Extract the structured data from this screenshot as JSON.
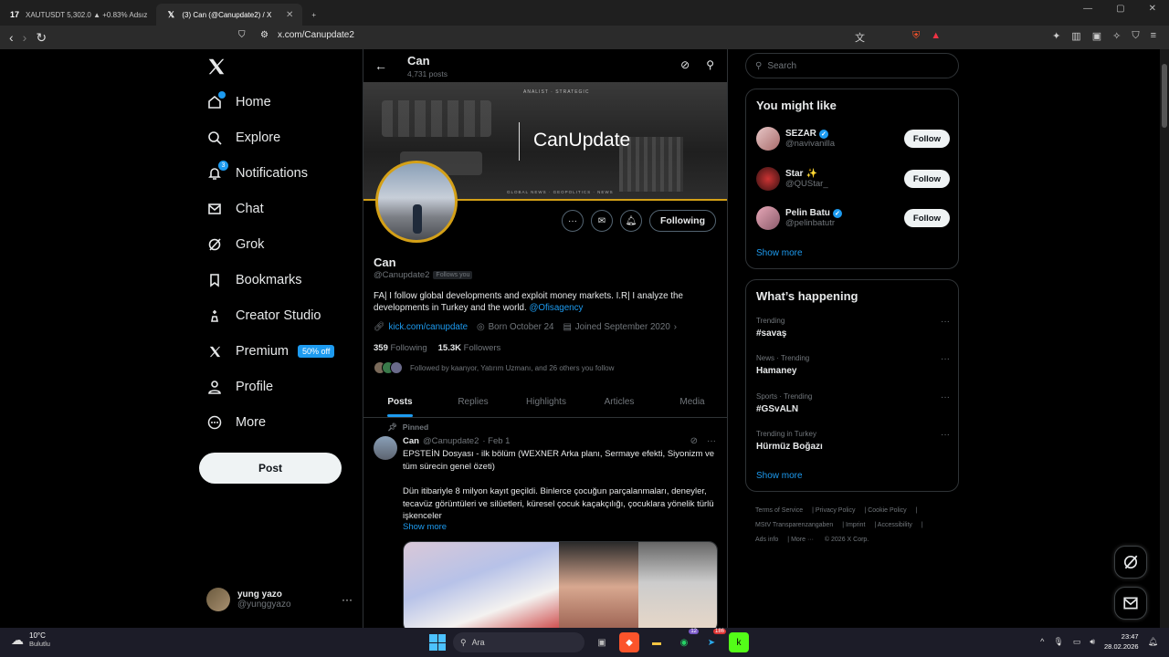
{
  "browser": {
    "tabs": [
      {
        "label": "XAUTUSDT 5,302.0 ▲ +0.83% Adsız",
        "icon": "tradingview-icon"
      },
      {
        "label": "(3) Can (@Canupdate2) / X",
        "icon": "x-icon"
      }
    ],
    "new_tab": "+",
    "url": "x.com/Canupdate2"
  },
  "nav": {
    "items": [
      {
        "label": "Home",
        "icon": "home-icon"
      },
      {
        "label": "Explore",
        "icon": "search-icon"
      },
      {
        "label": "Notifications",
        "icon": "bell-icon",
        "badge": "3"
      },
      {
        "label": "Chat",
        "icon": "mail-icon"
      },
      {
        "label": "Grok",
        "icon": "grok-icon"
      },
      {
        "label": "Bookmarks",
        "icon": "bookmark-icon"
      },
      {
        "label": "Creator Studio",
        "icon": "creator-studio-icon"
      },
      {
        "label": "Premium",
        "icon": "x-premium-icon",
        "pill": "50% off"
      },
      {
        "label": "Profile",
        "icon": "person-icon"
      },
      {
        "label": "More",
        "icon": "more-circle-icon"
      }
    ],
    "post_label": "Post",
    "account": {
      "name": "yung yazo",
      "handle": "@yunggyazo"
    }
  },
  "header": {
    "name": "Can",
    "posts": "4,731 posts"
  },
  "banner": {
    "title": "CanUpdate",
    "top_text": "ANALIST · STRATEGIC",
    "bottom_text": "GLOBAL NEWS · GEOPOLITICS · NEWS"
  },
  "profile": {
    "name": "Can",
    "handle": "@Canupdate2",
    "follows_you": "Follows you",
    "bio": "FA| I follow global developments and exploit money markets. I.R| I analyze the developments in Turkey and the world.",
    "bio_link": "@Ofisagency",
    "website": "kick.com/canupdate",
    "born": "Born October 24",
    "joined": "Joined September 2020",
    "following_count": "359",
    "following_label": "Following",
    "followers_count": "15.3K",
    "followers_label": "Followers",
    "followed_by": "Followed by kaanyor, Yatırım Uzmanı, and 26 others you follow",
    "following_button": "Following"
  },
  "tabs": [
    "Posts",
    "Replies",
    "Highlights",
    "Articles",
    "Media"
  ],
  "tweet": {
    "pinned": "Pinned",
    "name": "Can",
    "handle": "@Canupdate2",
    "date": "· Feb 1",
    "para1": "EPSTEİN Dosyası - ilk bölüm (WEXNER Arka planı, Sermaye efekti, Siyonizm ve tüm sürecin genel özeti)",
    "para2": "Dün itibariyle 8 milyon kayıt geçildi. Binlerce çocuğun parçalanmaları, deneyler, tecavüz görüntüleri ve silüetleri, küresel çocuk kaçakçılığı, çocuklara yönelik türlü işkenceler",
    "show_more": "Show more"
  },
  "sidebar": {
    "search_placeholder": "Search",
    "might_like_title": "You might like",
    "suggestions": [
      {
        "name": "SEZAR",
        "handle": "@navivanilla",
        "verified": true,
        "emoji": ""
      },
      {
        "name": "Star",
        "handle": "@QUStar_",
        "verified": false,
        "emoji": "✨"
      },
      {
        "name": "Pelin Batu",
        "handle": "@pelinbatutr",
        "verified": true,
        "emoji": ""
      }
    ],
    "follow_label": "Follow",
    "show_more": "Show more",
    "happening_title": "What’s happening",
    "trends": [
      {
        "context": "Trending",
        "title": "#savaş"
      },
      {
        "context": "News · Trending",
        "title": "Hamaney"
      },
      {
        "context": "Sports · Trending",
        "title": "#GSvALN"
      },
      {
        "context": "Trending in Turkey",
        "title": "Hürmüz Boğazı"
      }
    ],
    "footer": [
      "Terms of Service",
      "Privacy Policy",
      "Cookie Policy",
      "MStV Transparenzangaben",
      "Imprint",
      "Accessibility",
      "Ads info",
      "More ···",
      "© 2026 X Corp."
    ]
  },
  "taskbar": {
    "temp": "10°C",
    "weather": "Bulutlu",
    "search": "Ara",
    "time": "23:47",
    "date": "28.02.2026",
    "whatsapp_badge": "12",
    "telegram_badge": "186"
  },
  "colors": {
    "accent": "#1d9bf0",
    "banner_border": "#d4a017"
  }
}
